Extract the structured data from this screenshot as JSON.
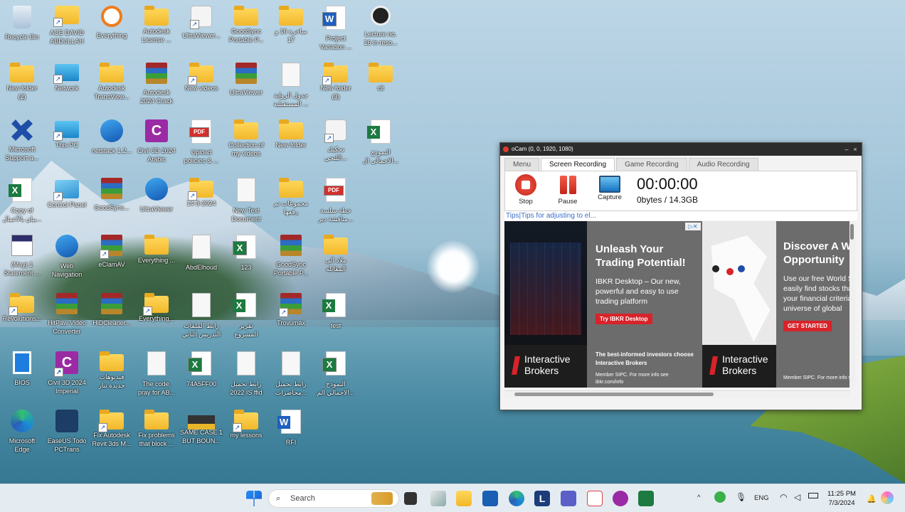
{
  "desktop": {
    "icons": [
      {
        "label": "Recycle Bin"
      },
      {
        "label": "ACE DAVID\nABDULLAH"
      },
      {
        "label": "Everything"
      },
      {
        "label": "Autodesk\nLicense ..."
      },
      {
        "label": "UltraViewer..."
      },
      {
        "label": "GoodSync\nPortable P..."
      },
      {
        "label": "ساخرة 16 و\n17"
      },
      {
        "label": "Project\nVariation ..."
      },
      {
        "label": "Lecture no.\n16 in reso..."
      },
      {
        "label": "New folder\n(2)"
      },
      {
        "label": "Network"
      },
      {
        "label": "Autodesk\nTransView..."
      },
      {
        "label": "Autodesk\n2024 Crack"
      },
      {
        "label": "New videos"
      },
      {
        "label": "UltraViewer"
      },
      {
        "label": "جدول الرواية\nالمستقبلية ..."
      },
      {
        "label": "New folder\n(3)"
      },
      {
        "label": "clt"
      },
      {
        "label": "Microsoft\nSupport a..."
      },
      {
        "label": "This PC"
      },
      {
        "label": "netstack 1.2..."
      },
      {
        "label": "Civil 3D 2024\nArabic"
      },
      {
        "label": "Upload\npolicies & ..."
      },
      {
        "label": "Collection of\nmy videos"
      },
      {
        "label": "New folder"
      },
      {
        "label": "تحكيك\nاللتحي..."
      },
      {
        "label": "النموذج\nالاجمالي ال..."
      },
      {
        "label": "Copy of\nبيان بالأعمال..."
      },
      {
        "label": "Control Panel"
      },
      {
        "label": "GoodSync..."
      },
      {
        "label": "UltraViewer"
      },
      {
        "label": "14-3-2024"
      },
      {
        "label": "New Text\nDocument"
      },
      {
        "label": "مجموعات تم\nرفعها"
      },
      {
        "label": "خطة سلسة\nمنافشة دبر..."
      },
      {
        "label": "(May) 1\nStatement ..."
      },
      {
        "label": "Web\nNavigation"
      },
      {
        "label": "eClamAV"
      },
      {
        "label": "Everything ..."
      },
      {
        "label": "AbdElhoud"
      },
      {
        "label": "123"
      },
      {
        "label": "GoodSync\nPortable P..."
      },
      {
        "label": "ملاذ الى\nالمقابلة"
      },
      {
        "label": "Revolutions..."
      },
      {
        "label": "HitPaw Video\nConverter"
      },
      {
        "label": "HiDCleaner..."
      },
      {
        "label": "Everything..."
      },
      {
        "label": "رابط الملفات\nالتدريس الثاني"
      },
      {
        "label": "تقرير\nالمشروع"
      },
      {
        "label": "Trovumax"
      },
      {
        "label": "test"
      },
      {
        "label": "BIOS"
      },
      {
        "label": "Civil 3D 2024\nImperial"
      },
      {
        "label": "فيديوهات\nجديدة تنار"
      },
      {
        "label": "The code,\npray for AB..."
      },
      {
        "label": "74A5FF00"
      },
      {
        "label": "رابط تحميل\n2022 IS ffid"
      },
      {
        "label": "رابط تحميل\nمحاضرات..."
      },
      {
        "label": "النموذج\nالاجمالي الم..."
      },
      {
        "label": "Microsoft\nEdge"
      },
      {
        "label": "EaseUS Todo\nPCTrans"
      },
      {
        "label": "Fix Autodesk\nRevit 3ds M..."
      },
      {
        "label": "Fix problems\nthat block ..."
      },
      {
        "label": "SAME CASE 1\nBUT BOUN..."
      },
      {
        "label": "my lessons"
      },
      {
        "label": "RFI"
      }
    ]
  },
  "ocam": {
    "title": "oCam (0, 0, 1920, 1080)",
    "tabs": [
      {
        "label": "Menu"
      },
      {
        "label": "Screen Recording"
      },
      {
        "label": "Game Recording"
      },
      {
        "label": "Audio Recording"
      }
    ],
    "tools": {
      "stop": "Stop",
      "pause": "Pause",
      "capture": "Capture"
    },
    "timer": "00:00:00",
    "size": "0bytes / 14.3GB",
    "tips": "Tips|Tips for adjusting to el...",
    "ad": {
      "headline": "Unleash Your Trading Potential!",
      "body": "IBKR Desktop – Our new, powerful and easy to use trading platform",
      "cta": "Try IBKR Desktop",
      "tagline": "The best-informed investors choose Interactive Brokers",
      "disclaimer": "Member SIPC. For more info see ibkr.com/info",
      "brand": "Interactive Brokers",
      "headline2": "Discover A World of Opportunity",
      "body2": "Use our free World Screener to easily find stocks that match your financial criteria across a universe of global",
      "cta2": "GET STARTED",
      "disclaimer2": "Member SIPC. For more info see ibkr.com/info"
    }
  },
  "taskbar": {
    "search_placeholder": "Search",
    "lang": "ENG",
    "time": "11:25 PM",
    "date": "7/3/2024"
  }
}
